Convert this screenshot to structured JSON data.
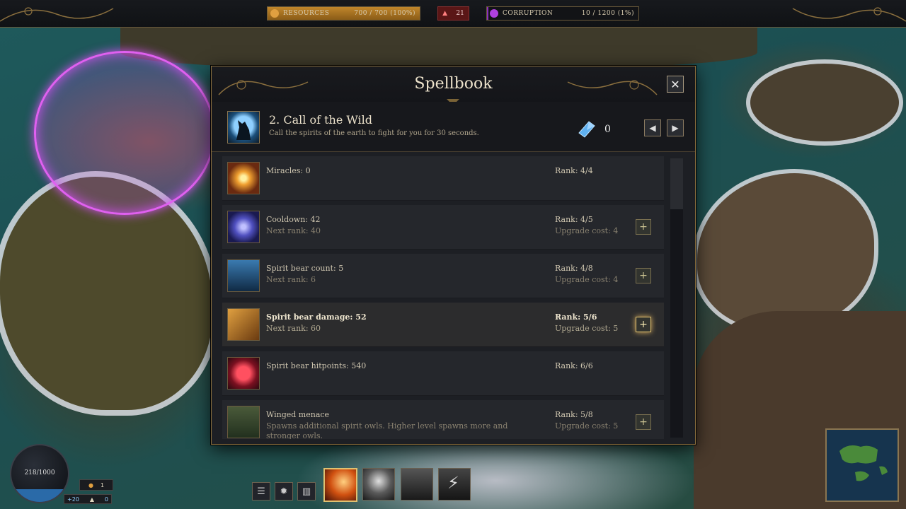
{
  "hud": {
    "resources": {
      "label": "RESOURCES",
      "value": "700 / 700 (100%)",
      "fraction": 1.0,
      "color": "#c0862b"
    },
    "alert": {
      "count": "21",
      "color": "#5a1616"
    },
    "corruption": {
      "label": "CORRUPTION",
      "value": "10 / 1200 (1%)",
      "fraction": 0.01,
      "color": "#8a2fbe"
    }
  },
  "spellbook": {
    "title": "Spellbook",
    "close_icon": "close-icon",
    "spell": {
      "name": "2. Call of the Wild",
      "description": "Call the spirits of the earth to fight for you for 30 seconds.",
      "icon": "wolf-howl-icon",
      "points": "0"
    },
    "upgrades": [
      {
        "name": "Miracles: 0",
        "next": "",
        "rank": "Rank: 4/4",
        "cost": "",
        "upgradable": false,
        "icon": "sunburst-icon"
      },
      {
        "name": "Cooldown: 42",
        "next": "Next rank: 40",
        "rank": "Rank: 4/5",
        "cost": "Upgrade cost: 4",
        "upgradable": true,
        "icon": "vortex-icon"
      },
      {
        "name": "Spirit bear count: 5",
        "next": "Next rank: 6",
        "rank": "Rank: 4/8",
        "cost": "Upgrade cost: 4",
        "upgradable": true,
        "icon": "bear-icon"
      },
      {
        "name": "Spirit bear damage: 52",
        "next": "Next rank: 60",
        "rank": "Rank: 5/6",
        "cost": "Upgrade cost: 5",
        "upgradable": true,
        "icon": "dagger-icon",
        "highlight": true
      },
      {
        "name": "Spirit bear hitpoints: 540",
        "next": "",
        "rank": "Rank: 6/6",
        "cost": "",
        "upgradable": false,
        "icon": "heart-icon"
      },
      {
        "name": "Winged menace",
        "next": "Spawns additional spirit owls. Higher level spawns more and stronger owls.",
        "rank": "Rank: 5/8",
        "cost": "Upgrade cost: 5",
        "upgradable": true,
        "icon": "owl-icon"
      }
    ]
  },
  "bottom_hud": {
    "mana": {
      "text": "218/1000",
      "fraction": 0.22
    },
    "stats": {
      "coins": "1",
      "income": "+20",
      "followers": "0"
    },
    "buttons": [
      "menu-icon",
      "sun-icon",
      "book-icon"
    ],
    "abilities": [
      "fire-slash-icon",
      "wolf-howl-icon",
      "werewolf-icon",
      "lightning-icon"
    ]
  }
}
